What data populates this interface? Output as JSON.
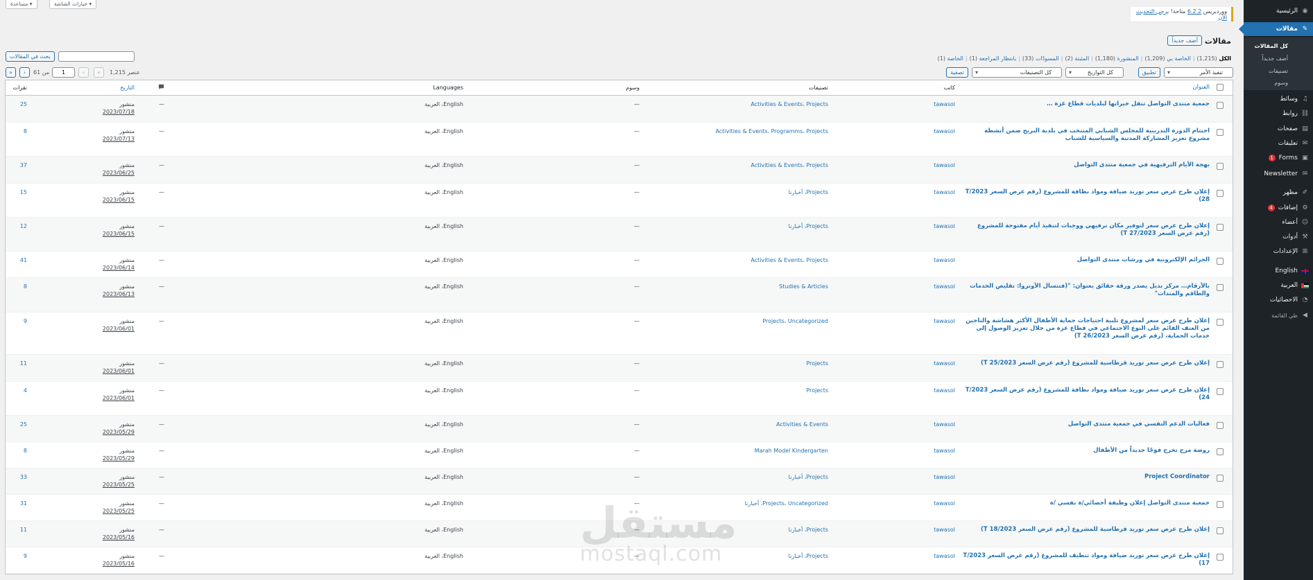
{
  "top_bar": {
    "screen_options": "خيارات الشاشة ▾",
    "help": "مساعدة ▾"
  },
  "notice": {
    "prefix": "ووردبريس",
    "version": "6.2.2",
    "middle": "متاحة!",
    "link": "يرجى التحديث الآن"
  },
  "page": {
    "title": "مقالات",
    "add_new": "أضف جديداً"
  },
  "status_links": [
    {
      "label": "الكل",
      "count": "(1,215)",
      "current": true
    },
    {
      "label": "الخاصة بي",
      "count": "(1,209)"
    },
    {
      "label": "المنشورة",
      "count": "(1,180)"
    },
    {
      "label": "المثبتة",
      "count": "(2)"
    },
    {
      "label": "المسودّات",
      "count": "(33)"
    },
    {
      "label": "بانتظار المراجعة",
      "count": "(1)"
    },
    {
      "label": "الخاصة",
      "count": "(1)"
    }
  ],
  "search": {
    "button": "بحث في المقالات",
    "value": ""
  },
  "bulk": {
    "action": "تنفيذ الأمر",
    "apply": "تطبيق",
    "dates": "كل التواريخ",
    "cats": "كل التصنيفات",
    "filter": "تصفية"
  },
  "pagination": {
    "count": "1,215 عنصر",
    "current": "1",
    "of": "من 61",
    "first": "«",
    "prev": "‹",
    "next": "›",
    "last": "»"
  },
  "columns": {
    "title": "العنوان",
    "author": "كاتب",
    "categories": "تصنيفات",
    "tags": "وسوم",
    "languages": "Languages",
    "date": "التاريخ",
    "views": "نقرات"
  },
  "posts": [
    {
      "title": "جمعية منتدى التواصل تنقل خبراتها لبلديات قطاع غزة …",
      "author": "tawasol",
      "categories": "Activities & Events، Projects",
      "tags": "—",
      "languages": "English، العربية",
      "comments": "—",
      "status": "منشور",
      "date": "2023/07/18",
      "views": "25"
    },
    {
      "title": "اختتام الدورة التدريبية للمجلس الشبابي المنتخب في بلدية البريج ضمن أنشطة مشروع تعزيز المشاركة المدنية والسياسية للشباب",
      "author": "tawasol",
      "categories": "Activities & Events، Programms، Projects",
      "tags": "—",
      "languages": "English، العربية",
      "comments": "—",
      "status": "منشور",
      "date": "2023/07/13",
      "views": "8"
    },
    {
      "title": "بهجة الأيام الترفيهية في جمعية منتدى التواصل",
      "author": "tawasol",
      "categories": "Activities & Events، Projects",
      "tags": "—",
      "languages": "English، العربية",
      "comments": "—",
      "status": "منشور",
      "date": "2023/06/25",
      "views": "37"
    },
    {
      "title": "إعلان طرح عرض سعر توريد ضيافة ومواد نظافة للمشروع (رقم عرض السعر T/2023 28)",
      "author": "tawasol",
      "categories": "Projects، أخبارنا",
      "tags": "—",
      "languages": "English، العربية",
      "comments": "—",
      "status": "منشور",
      "date": "2023/06/15",
      "views": "15"
    },
    {
      "title": "إعلان طرح عرض سعر لتوفير مكان ترفيهي ووجبات لتنفيذ أيام مفتوحة للمشروع (رقم عرض السعر T 27/2023)",
      "author": "tawasol",
      "categories": "Projects، أخبارنا",
      "tags": "—",
      "languages": "English، العربية",
      "comments": "—",
      "status": "منشور",
      "date": "2023/06/15",
      "views": "12"
    },
    {
      "title": "الجرائم الإلكترونية في ورشات منتدى التواصل",
      "author": "tawasol",
      "categories": "Activities & Events، Projects",
      "tags": "—",
      "languages": "English، العربية",
      "comments": "—",
      "status": "منشور",
      "date": "2023/06/14",
      "views": "41"
    },
    {
      "title": "بالأرقام… مركز بديل يصدر ورقة حقائق بعنوان: \"(فتنسال الأونروا: تقليص الخدمات والطاقم والمندات\"",
      "author": "tawasol",
      "categories": "Studies & Articles",
      "tags": "—",
      "languages": "English، العربية",
      "comments": "—",
      "status": "منشور",
      "date": "2023/06/13",
      "views": "8"
    },
    {
      "title": "إعلان طرح عرض سعر لمشروع تلبية احتياجات حماية الأطفال الأكثر هشاشة والناجين من العنف القائم على النوع الاجتماعي في قطاع غزة من خلال تعزيز الوصول إلى خدمات الحماية، (رقم عرض السعر T 26/2023)",
      "author": "tawasol",
      "categories": "Projects، Uncategorized",
      "tags": "—",
      "languages": "English، العربية",
      "comments": "—",
      "status": "منشور",
      "date": "2023/06/01",
      "views": "9"
    },
    {
      "title": "إعلان طرح عرض سعر توريد قرطاسية للمشروع (رقم عرض السعر T 25/2023)",
      "author": "tawasol",
      "categories": "Projects",
      "tags": "—",
      "languages": "English، العربية",
      "comments": "—",
      "status": "منشور",
      "date": "2023/06/01",
      "views": "11"
    },
    {
      "title": "إعلان طرح عرض سعر توريد ضيافة ومواد نظافة للمشروع (رقم عرض السعر T/2023 24)",
      "author": "tawasol",
      "categories": "Projects",
      "tags": "—",
      "languages": "English، العربية",
      "comments": "—",
      "status": "منشور",
      "date": "2023/06/01",
      "views": "4"
    },
    {
      "title": "فعاليات الدعم النفسي في جمعية منتدى التواصل",
      "author": "tawasol",
      "categories": "Activities & Events",
      "tags": "—",
      "languages": "English، العربية",
      "comments": "—",
      "status": "منشور",
      "date": "2023/05/29",
      "views": "25"
    },
    {
      "title": "روضة مرح تخرج فوجًا جديداً من الأطفال",
      "author": "tawasol",
      "categories": "Marah Model Kindergarten",
      "tags": "—",
      "languages": "English، العربية",
      "comments": "—",
      "status": "منشور",
      "date": "2023/05/29",
      "views": "8"
    },
    {
      "title": "Project Coordinator",
      "author": "tawasol",
      "categories": "Projects، أخبارنا",
      "tags": "—",
      "languages": "English، العربية",
      "comments": "—",
      "status": "منشور",
      "date": "2023/05/25",
      "views": "33"
    },
    {
      "title": "جمعية منتدى التواصل إعلان وظيفة أخصائي/ة نفسي /ة",
      "author": "tawasol",
      "categories": "Projects، Uncategorized، أخبارنا",
      "tags": "—",
      "languages": "English، العربية",
      "comments": "—",
      "status": "منشور",
      "date": "2023/05/25",
      "views": "31"
    },
    {
      "title": "إعلان طرح عرض سعر توريد قرطاسية للمشروع (رقم عرض السعر T 18/2023)",
      "author": "tawasol",
      "categories": "Projects، أخبارنا",
      "tags": "—",
      "languages": "English، العربية",
      "comments": "—",
      "status": "منشور",
      "date": "2023/05/16",
      "views": "11"
    },
    {
      "title": "إعلان طرح عرض سعر توريد ضيافة ومواد تنظيف للمشروع (رقم عرض السعر T/2023 17)",
      "author": "tawasol",
      "categories": "Projects، أخبارنا",
      "tags": "—",
      "languages": "English، العربية",
      "comments": "—",
      "status": "منشور",
      "date": "2023/05/16",
      "views": "9"
    }
  ],
  "menu": {
    "home": "الرئيسية",
    "posts": "مقالات",
    "sub_all": "كل المقالات",
    "sub_add": "أضف جديداً",
    "sub_cats": "تصنيفات",
    "sub_tags": "وسوم",
    "media": "وسائط",
    "links": "روابط",
    "pages": "صفحات",
    "comments": "تعليقات",
    "forms": "Forms",
    "forms_badge": "1",
    "newsletter": "Newsletter",
    "appearance": "مظهر",
    "plugins": "إضافات",
    "plugins_badge": "4",
    "users": "أعضاء",
    "tools": "أدوات",
    "settings": "الإعدادات",
    "english": "English",
    "arabic": "العربية",
    "stats": "الاحصائيات",
    "collapse": "طي القائمة"
  },
  "watermark": {
    "ar": "مستقل",
    "en": "mostaql.com"
  },
  "colors": {
    "accent": "#2271b1",
    "sidebar": "#1d2327",
    "notice": "#dba617",
    "badge": "#d63638"
  }
}
